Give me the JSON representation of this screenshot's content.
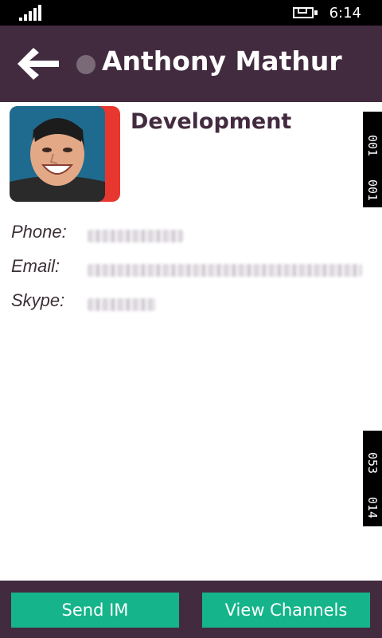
{
  "status_bar": {
    "time": "6:14",
    "signal_icon": "signal-strength-icon",
    "battery_icon": "battery-charging-icon"
  },
  "header": {
    "back_icon": "back-arrow-icon",
    "presence_icon": "presence-status-icon",
    "contact_name": "Anthony Mathur"
  },
  "profile": {
    "avatar_icon": "contact-avatar-image",
    "department": "Development",
    "accent_color": "#e8372e"
  },
  "details": {
    "phone_label": "Phone:",
    "email_label": "Email:",
    "skype_label": "Skype:"
  },
  "side_tags": {
    "top": [
      "001",
      "001"
    ],
    "bottom": [
      "053",
      "014"
    ]
  },
  "actions": {
    "send_im_label": "Send IM",
    "view_channels_label": "View Channels"
  },
  "colors": {
    "header_bg": "#432b3f",
    "button_bg": "#15b48b",
    "status_bg": "#000000"
  }
}
